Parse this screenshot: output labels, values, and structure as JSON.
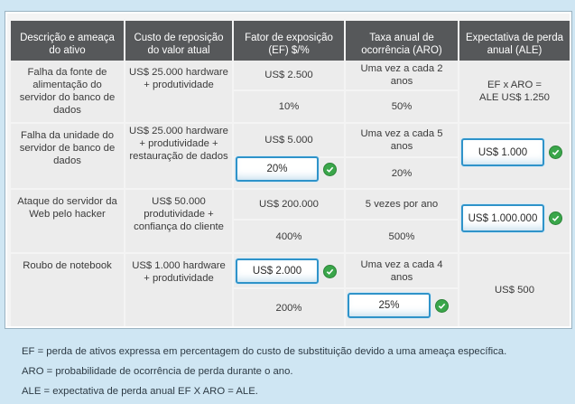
{
  "headers": [
    "Descrição e ameaça do ativo",
    "Custo de reposição do valor atual",
    "Fator de exposição (EF) $/%",
    "Taxa anual de ocorrência (ARO)",
    "Expectativa de perda anual (ALE)"
  ],
  "rows": [
    {
      "asset": "Falha da fonte de alimentação do servidor do banco de dados",
      "cost": "US$ 25.000 hardware + produtividade",
      "ef_value": "US$ 2.500",
      "ef_percent": "10%",
      "aro_text": "Uma vez a cada 2 anos",
      "aro_percent": "50%",
      "ale": "EF x ARO = ALE US$ 1.250"
    },
    {
      "asset": "Falha da unidade do servidor de banco de dados",
      "cost": "US$ 25.000 hardware + produtividade + restauração de dados",
      "ef_value": "US$ 5.000",
      "ef_percent": "20%",
      "aro_text": "Uma vez a cada 5 anos",
      "aro_percent": "20%",
      "ale": "US$ 1.000"
    },
    {
      "asset": "Ataque do servidor da Web pelo hacker",
      "cost": "US$ 50.000 produtividade + confiança do cliente",
      "ef_value": "US$ 200.000",
      "ef_percent": "400%",
      "aro_text": "5 vezes por ano",
      "aro_percent": "500%",
      "ale": "US$ 1.000.000"
    },
    {
      "asset": "Roubo de notebook",
      "cost": "US$ 1.000 hardware + produtividade",
      "ef_value": "US$ 2.000",
      "ef_percent": "200%",
      "aro_text": "Uma vez a cada 4 anos",
      "aro_percent": "25%",
      "ale": "US$ 500"
    }
  ],
  "notes": [
    "EF = perda de ativos expressa em percentagem do custo de substituição devido a uma ameaça específica.",
    "ARO = probabilidade de ocorrência de perda durante o ano.",
    "ALE = expectativa de perda anual EF X ARO = ALE."
  ],
  "colors": {
    "header_bg": "#56585a",
    "answer_border": "#2f93c9",
    "check_green": "#3aa64a",
    "page_bg": "#cfe6f3"
  },
  "icons": {
    "check": "check-circle-icon"
  }
}
